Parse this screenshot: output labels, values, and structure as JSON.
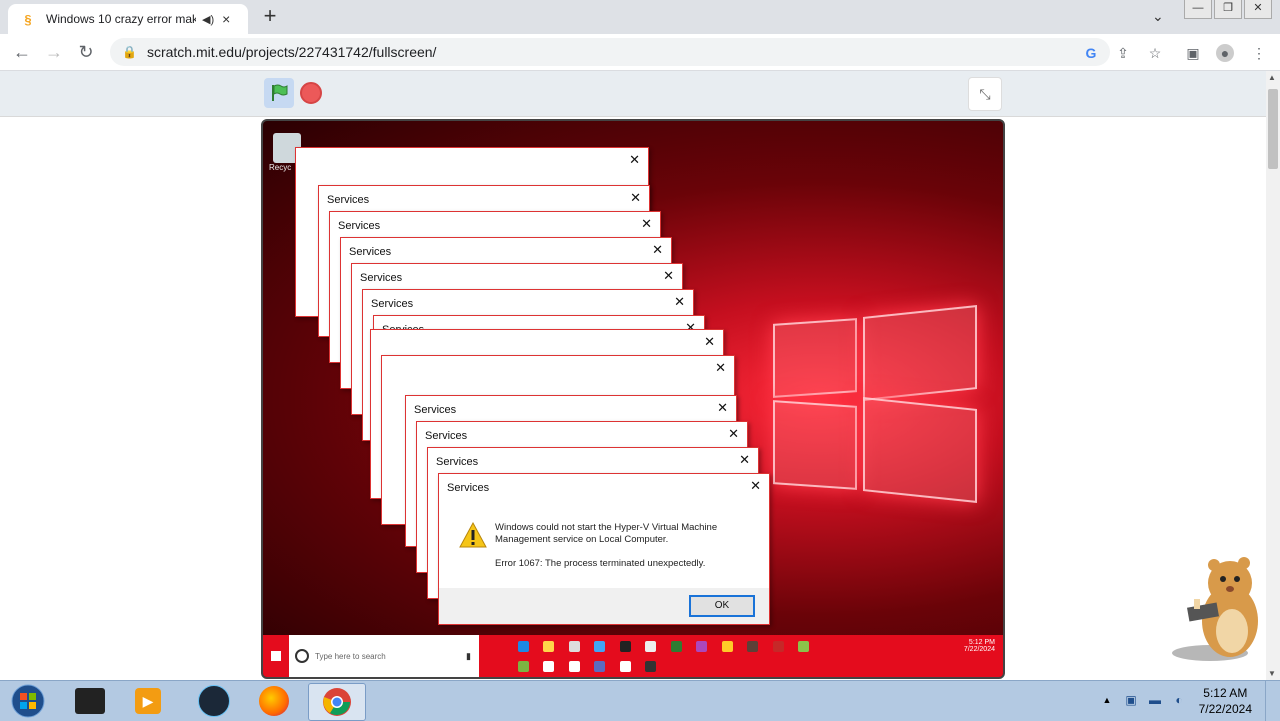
{
  "browser": {
    "tab": {
      "title": "Windows 10 crazy error mak",
      "favicon": "scratch-icon",
      "audio_icon": "speaker-icon",
      "close": "×"
    },
    "new_tab": "+",
    "url": "scratch.mit.edu/projects/227431742/fullscreen/"
  },
  "scratch": {
    "green_flag": "green-flag-icon",
    "stop": "stop-icon",
    "fullscreen": "exit-fullscreen-icon"
  },
  "stage": {
    "desktop_icon_label": "Recyc",
    "dialogs": [
      {
        "title": ""
      },
      {
        "title": "Services"
      },
      {
        "title": "Services"
      },
      {
        "title": "Services"
      },
      {
        "title": "Services"
      },
      {
        "title": "Services"
      },
      {
        "title": "Services"
      },
      {
        "title": ""
      },
      {
        "title": ""
      },
      {
        "title": "Services"
      },
      {
        "title": "Services"
      },
      {
        "title": "Services"
      },
      {
        "title": "Services"
      }
    ],
    "front_dialog": {
      "title": "Services",
      "message": "Windows could not start the Hyper-V Virtual Machine Management service on Local Computer.",
      "error": "Error 1067: The process terminated unexpectedly.",
      "ok": "OK"
    },
    "win_search_placeholder": "Type here to search",
    "win_clock": {
      "time": "5:12 PM",
      "date": "7/22/2024"
    }
  },
  "os_taskbar": {
    "clock_time": "5:12 AM",
    "clock_date": "7/22/2024",
    "apps": [
      "windows-start-icon",
      "terminal-icon",
      "media-player-icon",
      "steam-icon",
      "firefox-icon",
      "chrome-icon"
    ]
  }
}
